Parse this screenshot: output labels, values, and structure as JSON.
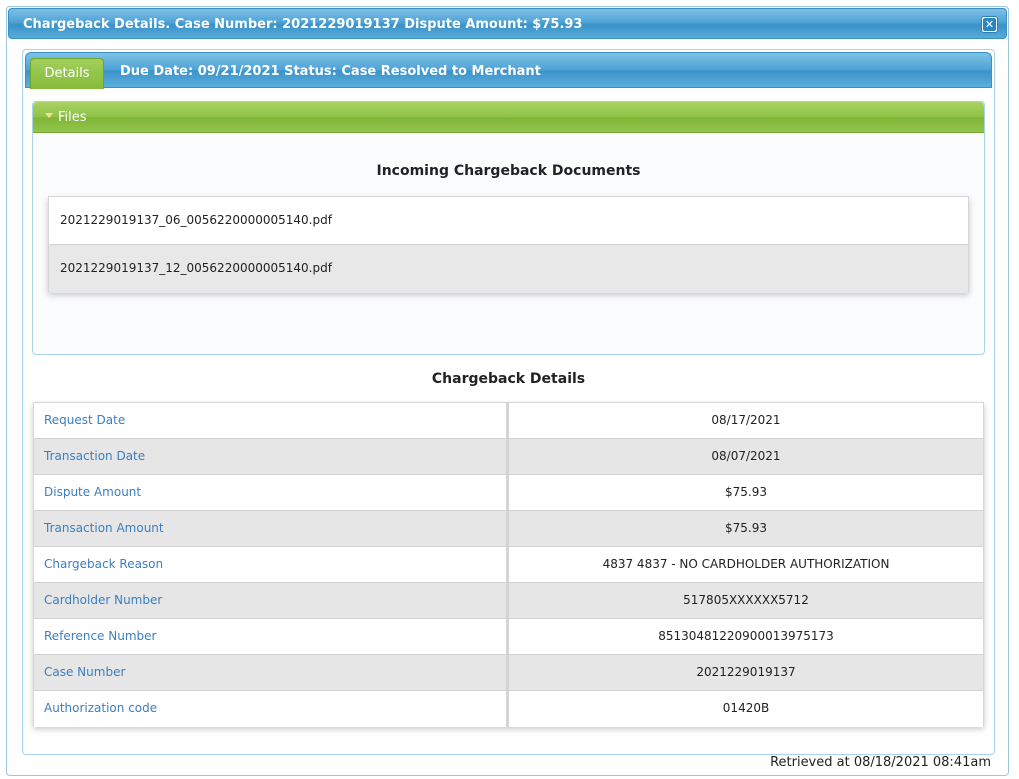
{
  "dialog": {
    "title": "Chargeback Details. Case Number: 2021229019137 Dispute Amount: $75.93",
    "close_symbol": "✕"
  },
  "tabbar": {
    "tab_label": "Details",
    "info": "Due Date: 09/21/2021 Status: Case Resolved to Merchant"
  },
  "files": {
    "header": "Files",
    "section_title": "Incoming Chargeback Documents",
    "documents": [
      "2021229019137_06_0056220000005140.pdf",
      "2021229019137_12_0056220000005140.pdf"
    ]
  },
  "details": {
    "section_title": "Chargeback Details",
    "rows": [
      {
        "label": "Request Date",
        "value": "08/17/2021"
      },
      {
        "label": "Transaction Date",
        "value": "08/07/2021"
      },
      {
        "label": "Dispute Amount",
        "value": "$75.93"
      },
      {
        "label": "Transaction Amount",
        "value": "$75.93"
      },
      {
        "label": "Chargeback Reason",
        "value": "4837 4837 - NO CARDHOLDER AUTHORIZATION"
      },
      {
        "label": "Cardholder Number",
        "value": "517805XXXXXX5712"
      },
      {
        "label": "Reference Number",
        "value": "85130481220900013975173"
      },
      {
        "label": "Case Number",
        "value": "2021229019137"
      },
      {
        "label": "Authorization code",
        "value": "01420B"
      }
    ]
  },
  "footer": {
    "retrieved": "Retrieved at 08/18/2021 08:41am"
  },
  "colors": {
    "header_blue": "#4fa3d6",
    "tab_green": "#86bb3c",
    "label_blue": "#3a7fc0"
  }
}
